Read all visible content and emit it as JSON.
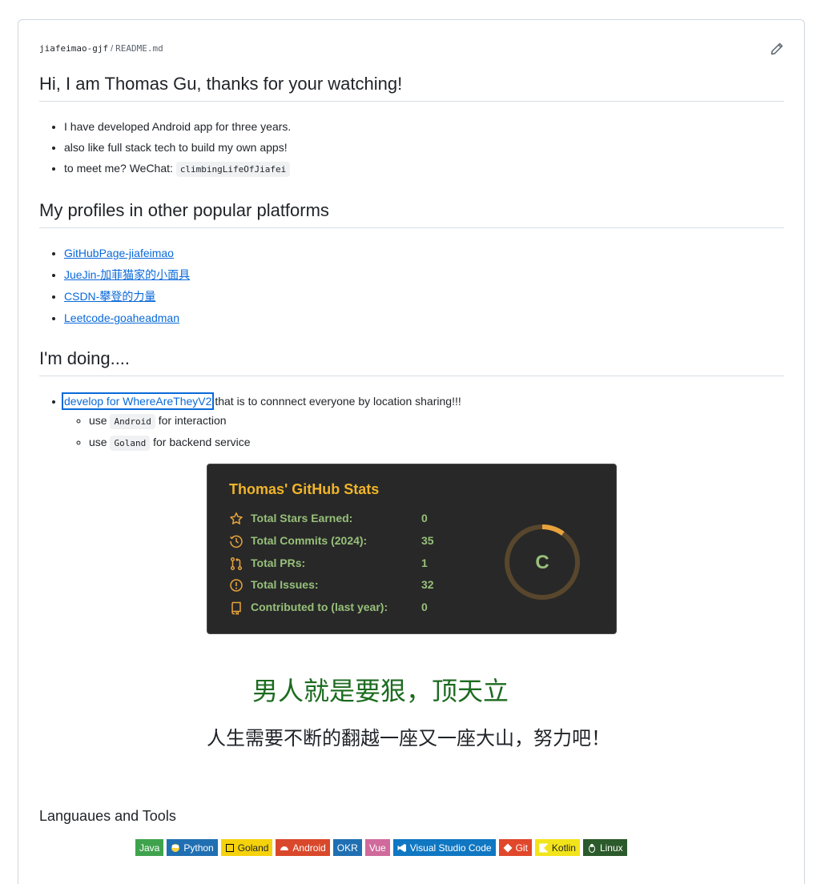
{
  "breadcrumb": {
    "owner": "jiafeimao-gjf",
    "separator": "/",
    "file": "README.md"
  },
  "heading_intro": "Hi, I am Thomas Gu, thanks for your watching!",
  "intro_items": [
    {
      "text": "I have developed Android app for three years."
    },
    {
      "text": "also like full stack tech to build my own apps!"
    },
    {
      "text": "to meet me? WeChat: ",
      "code": "climbingLifeOfJiafei"
    }
  ],
  "heading_profiles": "My profiles in other popular platforms",
  "profile_links": [
    "GitHubPage-jiafeimao",
    "JueJin-加菲猫家的小面具",
    "CSDN-攀登的力量",
    "Leetcode-goaheadman"
  ],
  "heading_doing": "I'm doing....",
  "doing": {
    "link": "develop for WhereAreTheyV2",
    "rest": " that is to connnect everyone by location sharing!!!",
    "sub": [
      {
        "pre": "use ",
        "code": "Android",
        "post": " for interaction"
      },
      {
        "pre": "use ",
        "code": "Goland",
        "post": " for backend service"
      }
    ]
  },
  "stats_card": {
    "title": "Thomas' GitHub Stats",
    "rows": [
      {
        "label": "Total Stars Earned:",
        "value": "0",
        "icon": "star-icon"
      },
      {
        "label": "Total Commits (2024):",
        "value": "35",
        "icon": "history-icon"
      },
      {
        "label": "Total PRs:",
        "value": "1",
        "icon": "pull-request-icon"
      },
      {
        "label": "Total Issues:",
        "value": "32",
        "icon": "issue-icon"
      },
      {
        "label": "Contributed to (last year):",
        "value": "0",
        "icon": "repo-icon"
      }
    ],
    "rank": "C",
    "rank_progress": 0.1,
    "colors": {
      "title": "#f0b429",
      "text": "#97c07a",
      "icon": "#e8a33c",
      "bg": "#282828"
    }
  },
  "quote_line1": "男人就是要狠，顶天立",
  "quote_line2": "人生需要不断的翻越一座又一座大山，努力吧！",
  "tools_heading": "Languaues and Tools",
  "badges": [
    {
      "label": "Java",
      "color": "#3fa34d",
      "icon": ""
    },
    {
      "label": "Python",
      "color": "#1f6fb2",
      "icon": "python-icon"
    },
    {
      "label": "Goland",
      "color": "#f5d20c",
      "icon": "goland-icon",
      "dark": true
    },
    {
      "label": "Android",
      "color": "#d9482b",
      "icon": "android-icon"
    },
    {
      "label": "OKR",
      "color": "#1f6fb2",
      "icon": ""
    },
    {
      "label": "Vue",
      "color": "#d06a9c",
      "icon": ""
    },
    {
      "label": "Visual Studio Code",
      "color": "#1077c2",
      "icon": "vscode-icon"
    },
    {
      "label": "Git",
      "color": "#e0472b",
      "icon": "git-icon"
    },
    {
      "label": "Kotlin",
      "color": "#f2e41b",
      "icon": "kotlin-icon",
      "dark": true
    },
    {
      "label": "Linux",
      "color": "#2b5a2b",
      "icon": "linux-icon"
    }
  ]
}
